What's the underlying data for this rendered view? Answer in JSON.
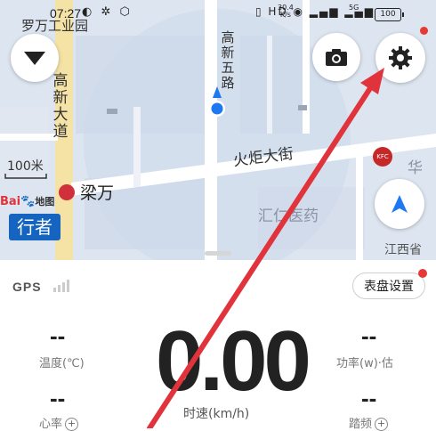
{
  "status_bar": {
    "time": "07:27",
    "left_icons": "◐ ✲ ⬡",
    "right_icons": "▯ HD ◉ ▂▄▆ ▂▄▆",
    "net_speed_value": "30.4",
    "net_speed_unit": "K/s",
    "signal_label": "5G",
    "battery": "100"
  },
  "map": {
    "labels": {
      "luowan": "罗万工业园",
      "gaoxin_dadao": "高新大道",
      "gaoxin_wulu": "高新五路",
      "huoju_dajie": "火炬大街",
      "liangwan": "梁万",
      "huizhong": "汇仁医药",
      "hua": "华",
      "jiangxi": "江西省"
    },
    "scale_label": "100米",
    "baidu_brand": "Bai",
    "baidu_map": "地图",
    "xingzhe": "行者",
    "kfc": "KFC"
  },
  "panel": {
    "gps_label": "GPS",
    "dial_settings_label": "表盘设置",
    "temperature_value": "--",
    "temperature_label": "温度(℃)",
    "power_value": "--",
    "power_label": "功率(w)·估",
    "heart_rate_value": "--",
    "heart_rate_label": "心率",
    "cadence_value": "--",
    "cadence_label": "踏频",
    "speed_value": "0.00",
    "speed_label": "时速(km/h)"
  },
  "colors": {
    "map_bg": "#dfe6f1",
    "road": "#ffffff",
    "highlight_road": "#f7e3a6",
    "accent_blue": "#1e78f0",
    "annotation_red": "#e0333b"
  }
}
